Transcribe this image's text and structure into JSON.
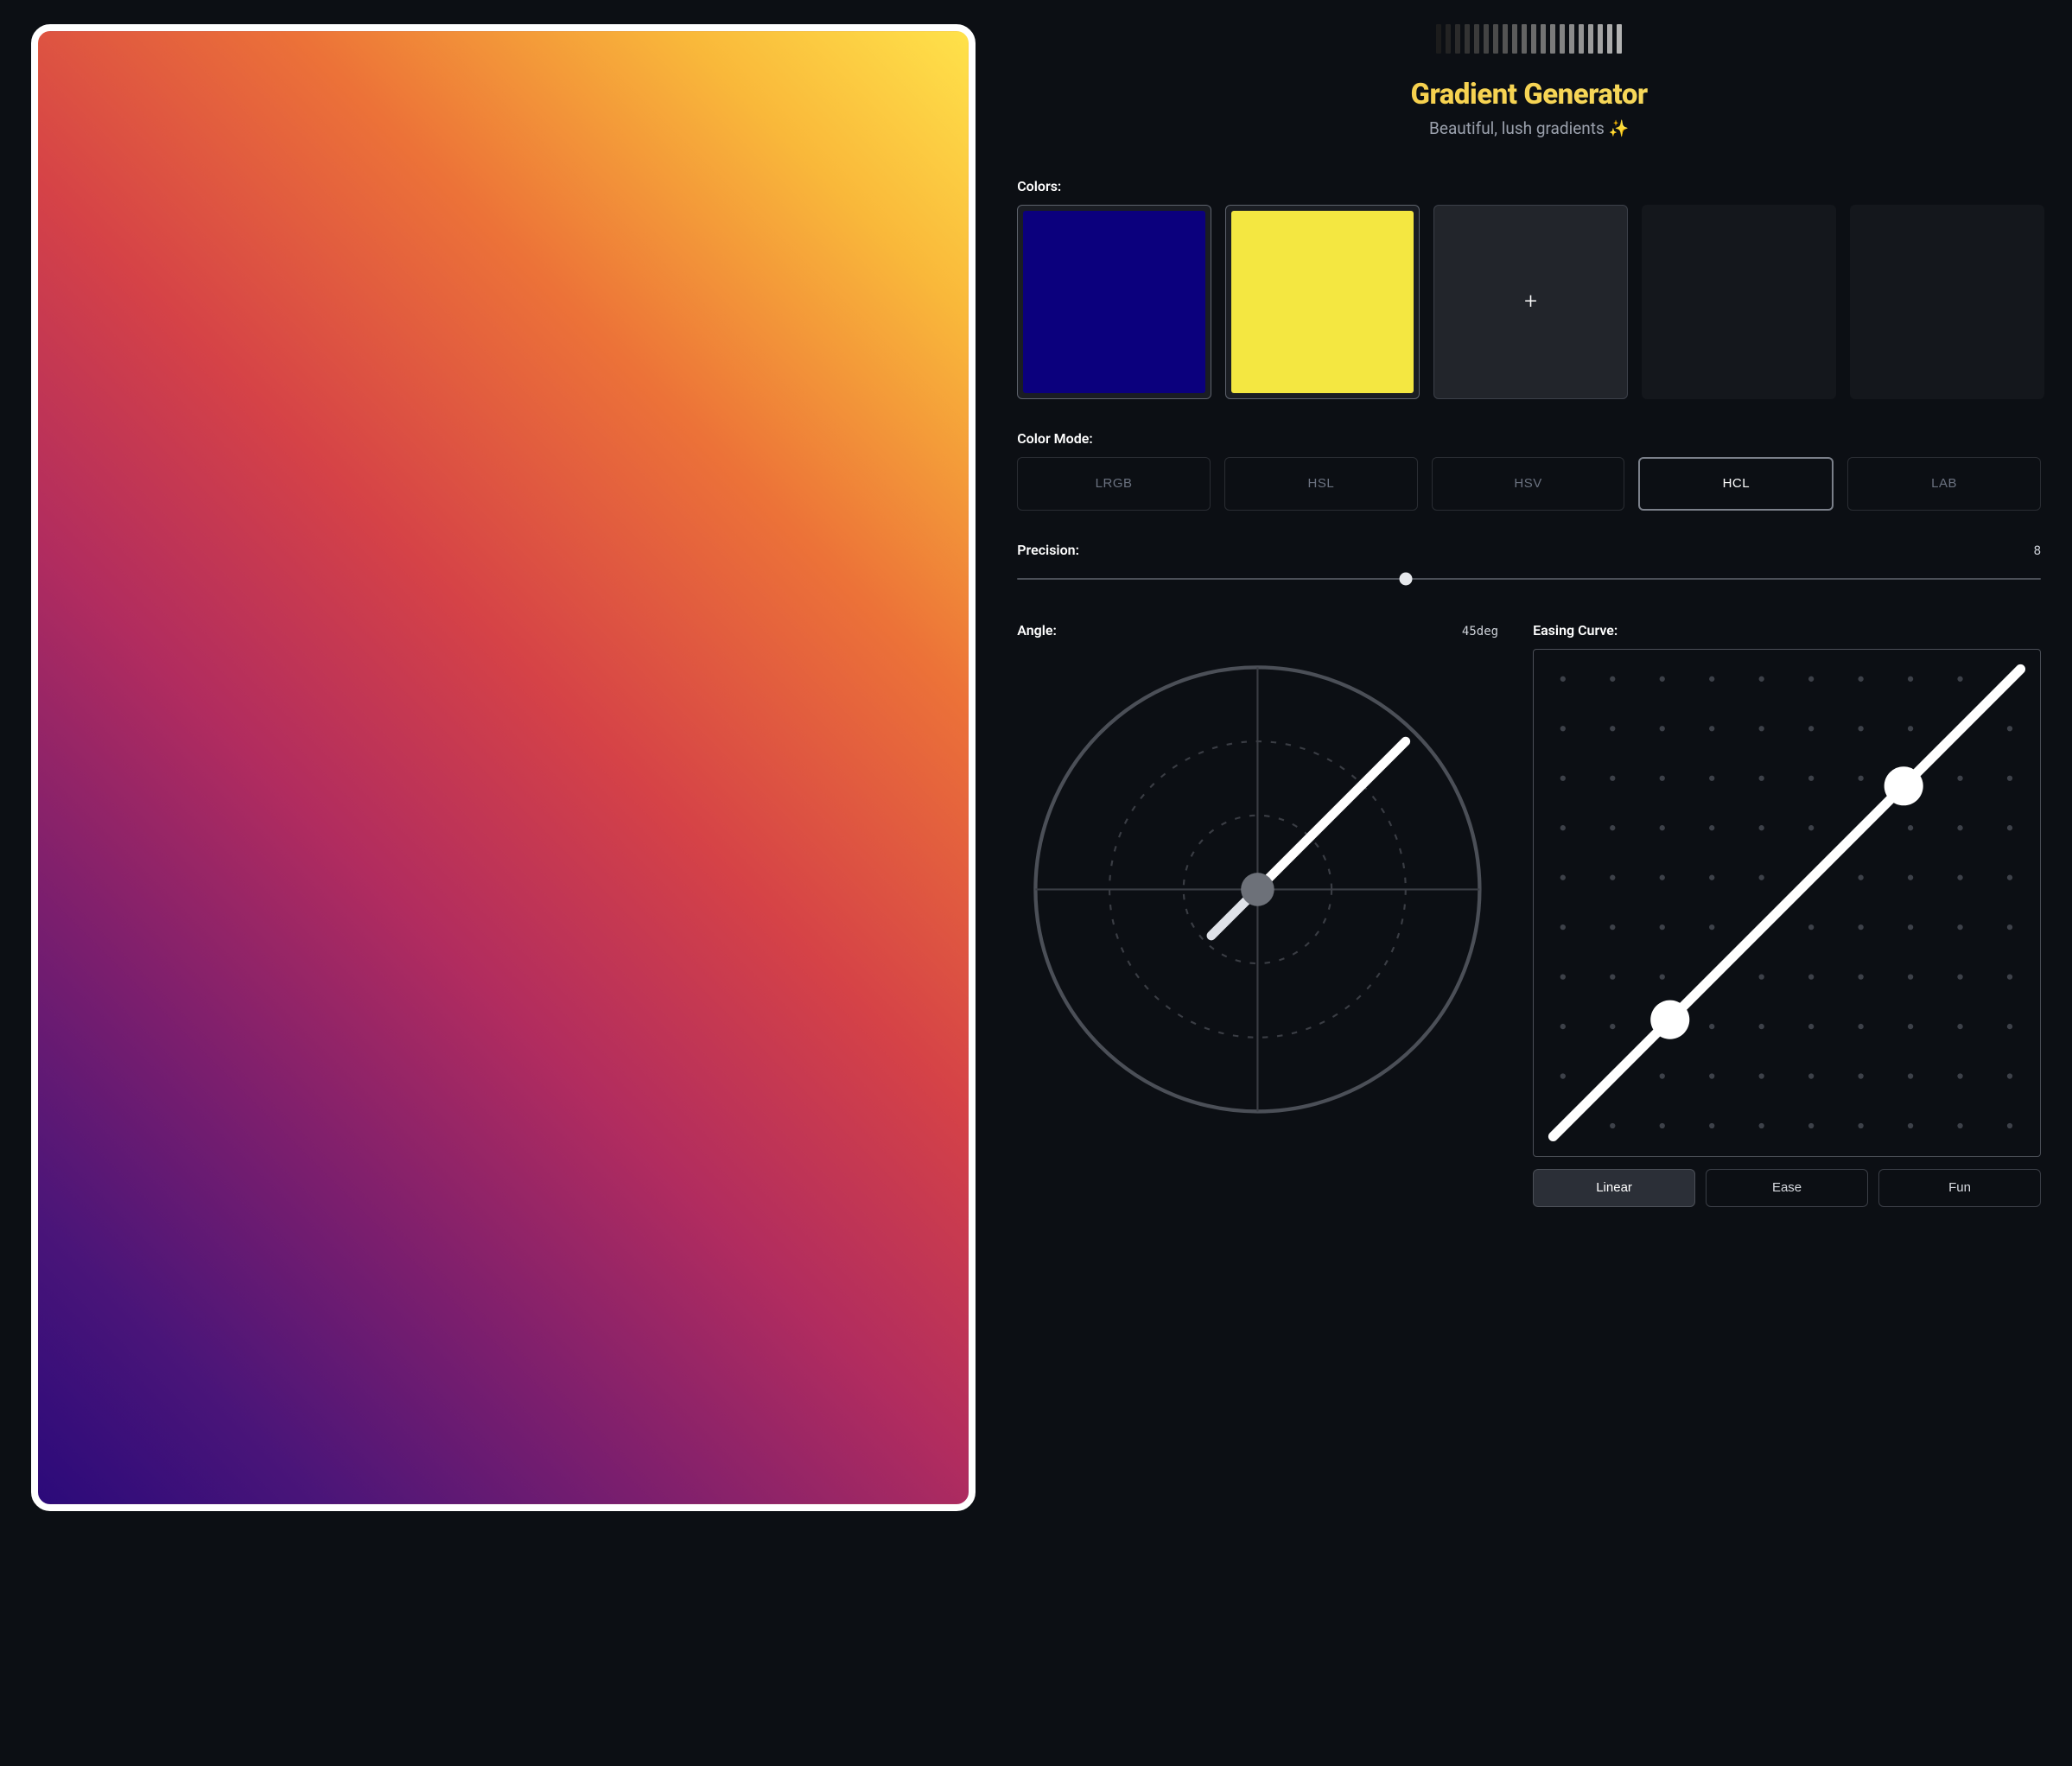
{
  "header": {
    "title": "Gradient Generator",
    "subtitle": "Beautiful, lush gradients ✨",
    "bar_colors": [
      "#1c1c1c",
      "#232323",
      "#2b2b2b",
      "#333333",
      "#3b3b3b",
      "#434343",
      "#4b4b4b",
      "#535353",
      "#5b5b5b",
      "#636363",
      "#6b6b6b",
      "#737373",
      "#7b7b7b",
      "#838383",
      "#8b8b8b",
      "#939393",
      "#9b9b9b",
      "#a3a3a3",
      "#ababab",
      "#b3b3b3"
    ]
  },
  "preview": {
    "angle_deg": 45,
    "stops": [
      "#2b0a7a",
      "#4a1579",
      "#7a1e6e",
      "#b12c5f",
      "#d54247",
      "#ec7238",
      "#f9b83a",
      "#ffe24a"
    ]
  },
  "colors": {
    "label": "Colors:",
    "swatches": [
      {
        "type": "filled",
        "value": "#0b007d"
      },
      {
        "type": "filled",
        "value": "#f4e741"
      },
      {
        "type": "add"
      },
      {
        "type": "empty"
      },
      {
        "type": "empty"
      }
    ]
  },
  "color_mode": {
    "label": "Color Mode:",
    "options": [
      "LRGB",
      "HSL",
      "HSV",
      "HCL",
      "LAB"
    ],
    "selected": "HCL"
  },
  "precision": {
    "label": "Precision:",
    "value": 8,
    "min": 0,
    "max": 20,
    "thumb_percent": 38
  },
  "angle": {
    "label": "Angle:",
    "value_display": "45deg",
    "degrees": 45
  },
  "easing": {
    "label": "Easing Curve:",
    "control_points": {
      "p1": [
        0.25,
        0.25
      ],
      "p2": [
        0.75,
        0.75
      ]
    },
    "presets": [
      "Linear",
      "Ease",
      "Fun"
    ],
    "selected": "Linear"
  }
}
